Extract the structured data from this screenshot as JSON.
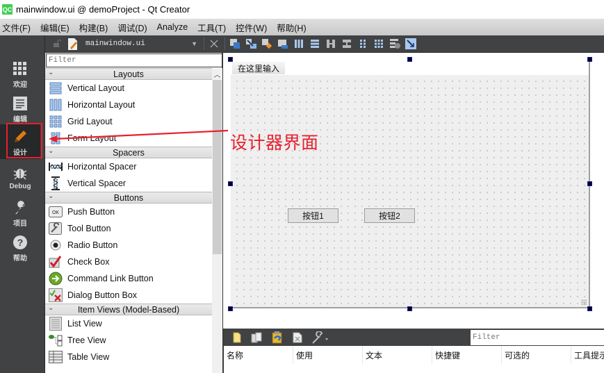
{
  "window": {
    "title": "mainwindow.ui @ demoProject - Qt Creator",
    "logo": "QC"
  },
  "menubar": {
    "items": [
      "文件(F)",
      "编辑(E)",
      "构建(B)",
      "调试(D)",
      "Analyze",
      "工具(T)",
      "控件(W)",
      "帮助(H)"
    ]
  },
  "modes": [
    {
      "label": "欢迎",
      "icon": "grid-icon",
      "active": false
    },
    {
      "label": "编辑",
      "icon": "document-icon",
      "active": false
    },
    {
      "label": "设计",
      "icon": "pencil-icon",
      "active": true
    },
    {
      "label": "Debug",
      "icon": "bug-icon",
      "active": false
    },
    {
      "label": "项目",
      "icon": "wrench-icon",
      "active": false
    },
    {
      "label": "帮助",
      "icon": "help-icon",
      "active": false
    }
  ],
  "editor_toolbar": {
    "file_name": "mainwindow.ui",
    "tools": [
      "edit-widgets",
      "edit-signals-slots",
      "edit-buddies",
      "edit-tab-order",
      "lay-out-horizontally",
      "lay-out-vertically",
      "lay-out-horizontally-splitter",
      "lay-out-vertically-splitter",
      "lay-out-form",
      "lay-out-grid",
      "break-layout",
      "adjust-size"
    ]
  },
  "widget_box": {
    "filter_placeholder": "Filter",
    "categories": [
      {
        "name": "Layouts",
        "items": [
          "Vertical Layout",
          "Horizontal Layout",
          "Grid Layout",
          "Form Layout"
        ]
      },
      {
        "name": "Spacers",
        "items": [
          "Horizontal Spacer",
          "Vertical Spacer"
        ]
      },
      {
        "name": "Buttons",
        "items": [
          "Push Button",
          "Tool Button",
          "Radio Button",
          "Check Box",
          "Command Link Button",
          "Dialog Button Box"
        ]
      },
      {
        "name": "Item Views (Model-Based)",
        "items": [
          "List View",
          "Tree View",
          "Table View"
        ]
      }
    ]
  },
  "form": {
    "menu_placeholder": "在这里输入",
    "buttons": [
      "按钮1",
      "按钮2"
    ]
  },
  "annotation": {
    "text": "设计器界面",
    "color": "#e8202c"
  },
  "action_editor": {
    "filter_placeholder": "Filter",
    "columns": [
      "名称",
      "使用",
      "文本",
      "快捷键",
      "可选的",
      "工具提示"
    ]
  },
  "colors": {
    "dark_panel": "#404244",
    "active_mode": "#262829",
    "highlight": "#e8202c",
    "handle": "#1a1ab5"
  }
}
